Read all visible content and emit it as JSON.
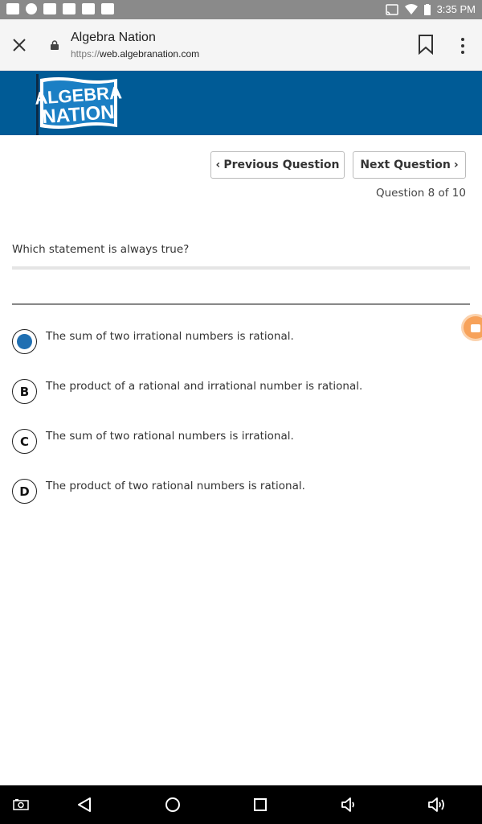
{
  "status_bar": {
    "time": "3:35 PM",
    "left_icons": [
      "video-icon",
      "snapchat-icon",
      "image-icon",
      "gmail-icon",
      "youtube-icon",
      "app-icon"
    ],
    "right_icons": [
      "cast-icon",
      "wifi-icon",
      "battery-icon"
    ]
  },
  "browser": {
    "title": "Algebra Nation",
    "url_scheme": "https://",
    "url_host": "web.algebranation.com"
  },
  "banner": {
    "logo_line1": "ALGEBRA",
    "logo_line2": "NATION",
    "background_color": "#005b96"
  },
  "quiz": {
    "prev_label": "Previous Question",
    "next_label": "Next Question",
    "counter": "Question 8 of 10",
    "question": "Which statement is always true?",
    "selected_index": 0,
    "accent_color": "#1f6fb2",
    "choices": [
      {
        "letter": "A",
        "text": "The sum of two irrational numbers is rational."
      },
      {
        "letter": "B",
        "text": "The product of a rational and irrational number is rational."
      },
      {
        "letter": "C",
        "text": "The sum of two rational numbers is irrational."
      },
      {
        "letter": "D",
        "text": "The product of two rational numbers is rational."
      }
    ]
  }
}
